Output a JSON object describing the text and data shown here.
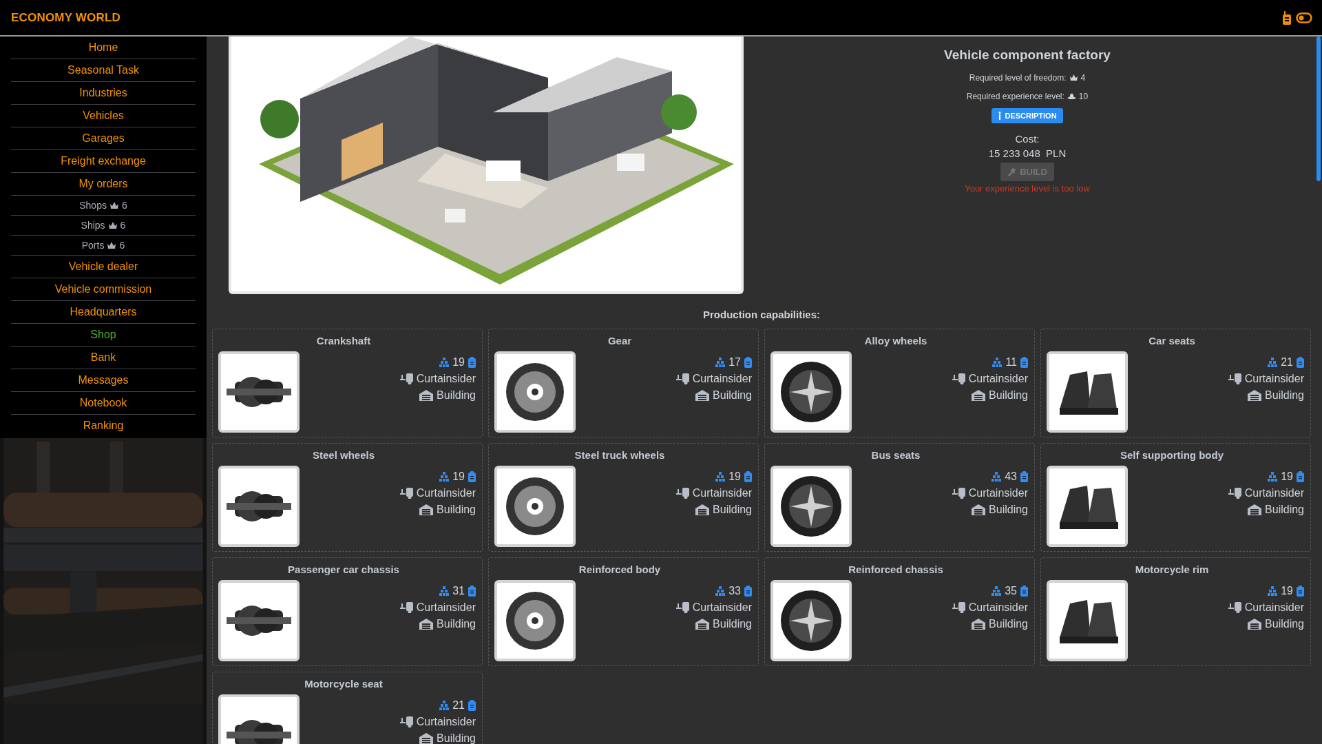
{
  "header": {
    "title": "ECONOMY WORLD"
  },
  "sidebar": {
    "items": [
      {
        "label": "Home",
        "kind": "link"
      },
      {
        "label": "Seasonal Task",
        "kind": "link"
      },
      {
        "label": "Industries",
        "kind": "link"
      },
      {
        "label": "Vehicles",
        "kind": "link"
      },
      {
        "label": "Garages",
        "kind": "link"
      },
      {
        "label": "Freight exchange",
        "kind": "link"
      },
      {
        "label": "My orders",
        "kind": "link"
      },
      {
        "label": "Shops",
        "kind": "locked",
        "count": "6"
      },
      {
        "label": "Ships",
        "kind": "locked",
        "count": "6"
      },
      {
        "label": "Ports",
        "kind": "locked",
        "count": "6"
      },
      {
        "label": "Vehicle dealer",
        "kind": "link"
      },
      {
        "label": "Vehicle commission",
        "kind": "link"
      },
      {
        "label": "Headquarters",
        "kind": "link"
      },
      {
        "label": "Shop",
        "kind": "highlight"
      },
      {
        "label": "Bank",
        "kind": "link"
      },
      {
        "label": "Messages",
        "kind": "link"
      },
      {
        "label": "Notebook",
        "kind": "link"
      },
      {
        "label": "Ranking",
        "kind": "link"
      }
    ]
  },
  "building": {
    "title": "Vehicle component factory",
    "requirements": [
      {
        "kind": "freedom",
        "label": "Required level of freedom:",
        "value": "4"
      },
      {
        "kind": "experience",
        "label": "Required experience level:",
        "value": "10"
      }
    ],
    "description_button": "DESCRIPTION",
    "cost_label": "Cost:",
    "cost": "15 233 048  PLN",
    "build_button": {
      "label": "BUILD",
      "disabled": true
    },
    "error": "Your experience level is too low"
  },
  "production": {
    "heading": "Production capabilities:",
    "products": [
      {
        "name": "Crankshaft",
        "count": "19",
        "transport": "Curtainsider",
        "source": "Building"
      },
      {
        "name": "Gear",
        "count": "17",
        "transport": "Curtainsider",
        "source": "Building"
      },
      {
        "name": "Alloy wheels",
        "count": "11",
        "transport": "Curtainsider",
        "source": "Building"
      },
      {
        "name": "Car seats",
        "count": "21",
        "transport": "Curtainsider",
        "source": "Building"
      },
      {
        "name": "Steel wheels",
        "count": "19",
        "transport": "Curtainsider",
        "source": "Building"
      },
      {
        "name": "Steel truck wheels",
        "count": "19",
        "transport": "Curtainsider",
        "source": "Building"
      },
      {
        "name": "Bus seats",
        "count": "43",
        "transport": "Curtainsider",
        "source": "Building"
      },
      {
        "name": "Self supporting body",
        "count": "19",
        "transport": "Curtainsider",
        "source": "Building"
      },
      {
        "name": "Passenger car chassis",
        "count": "31",
        "transport": "Curtainsider",
        "source": "Building"
      },
      {
        "name": "Reinforced body",
        "count": "33",
        "transport": "Curtainsider",
        "source": "Building"
      },
      {
        "name": "Reinforced chassis",
        "count": "35",
        "transport": "Curtainsider",
        "source": "Building"
      },
      {
        "name": "Motorcycle rim",
        "count": "19",
        "transport": "Curtainsider",
        "source": "Building"
      },
      {
        "name": "Motorcycle seat",
        "count": "21",
        "transport": "Curtainsider",
        "source": "Building"
      }
    ]
  }
}
